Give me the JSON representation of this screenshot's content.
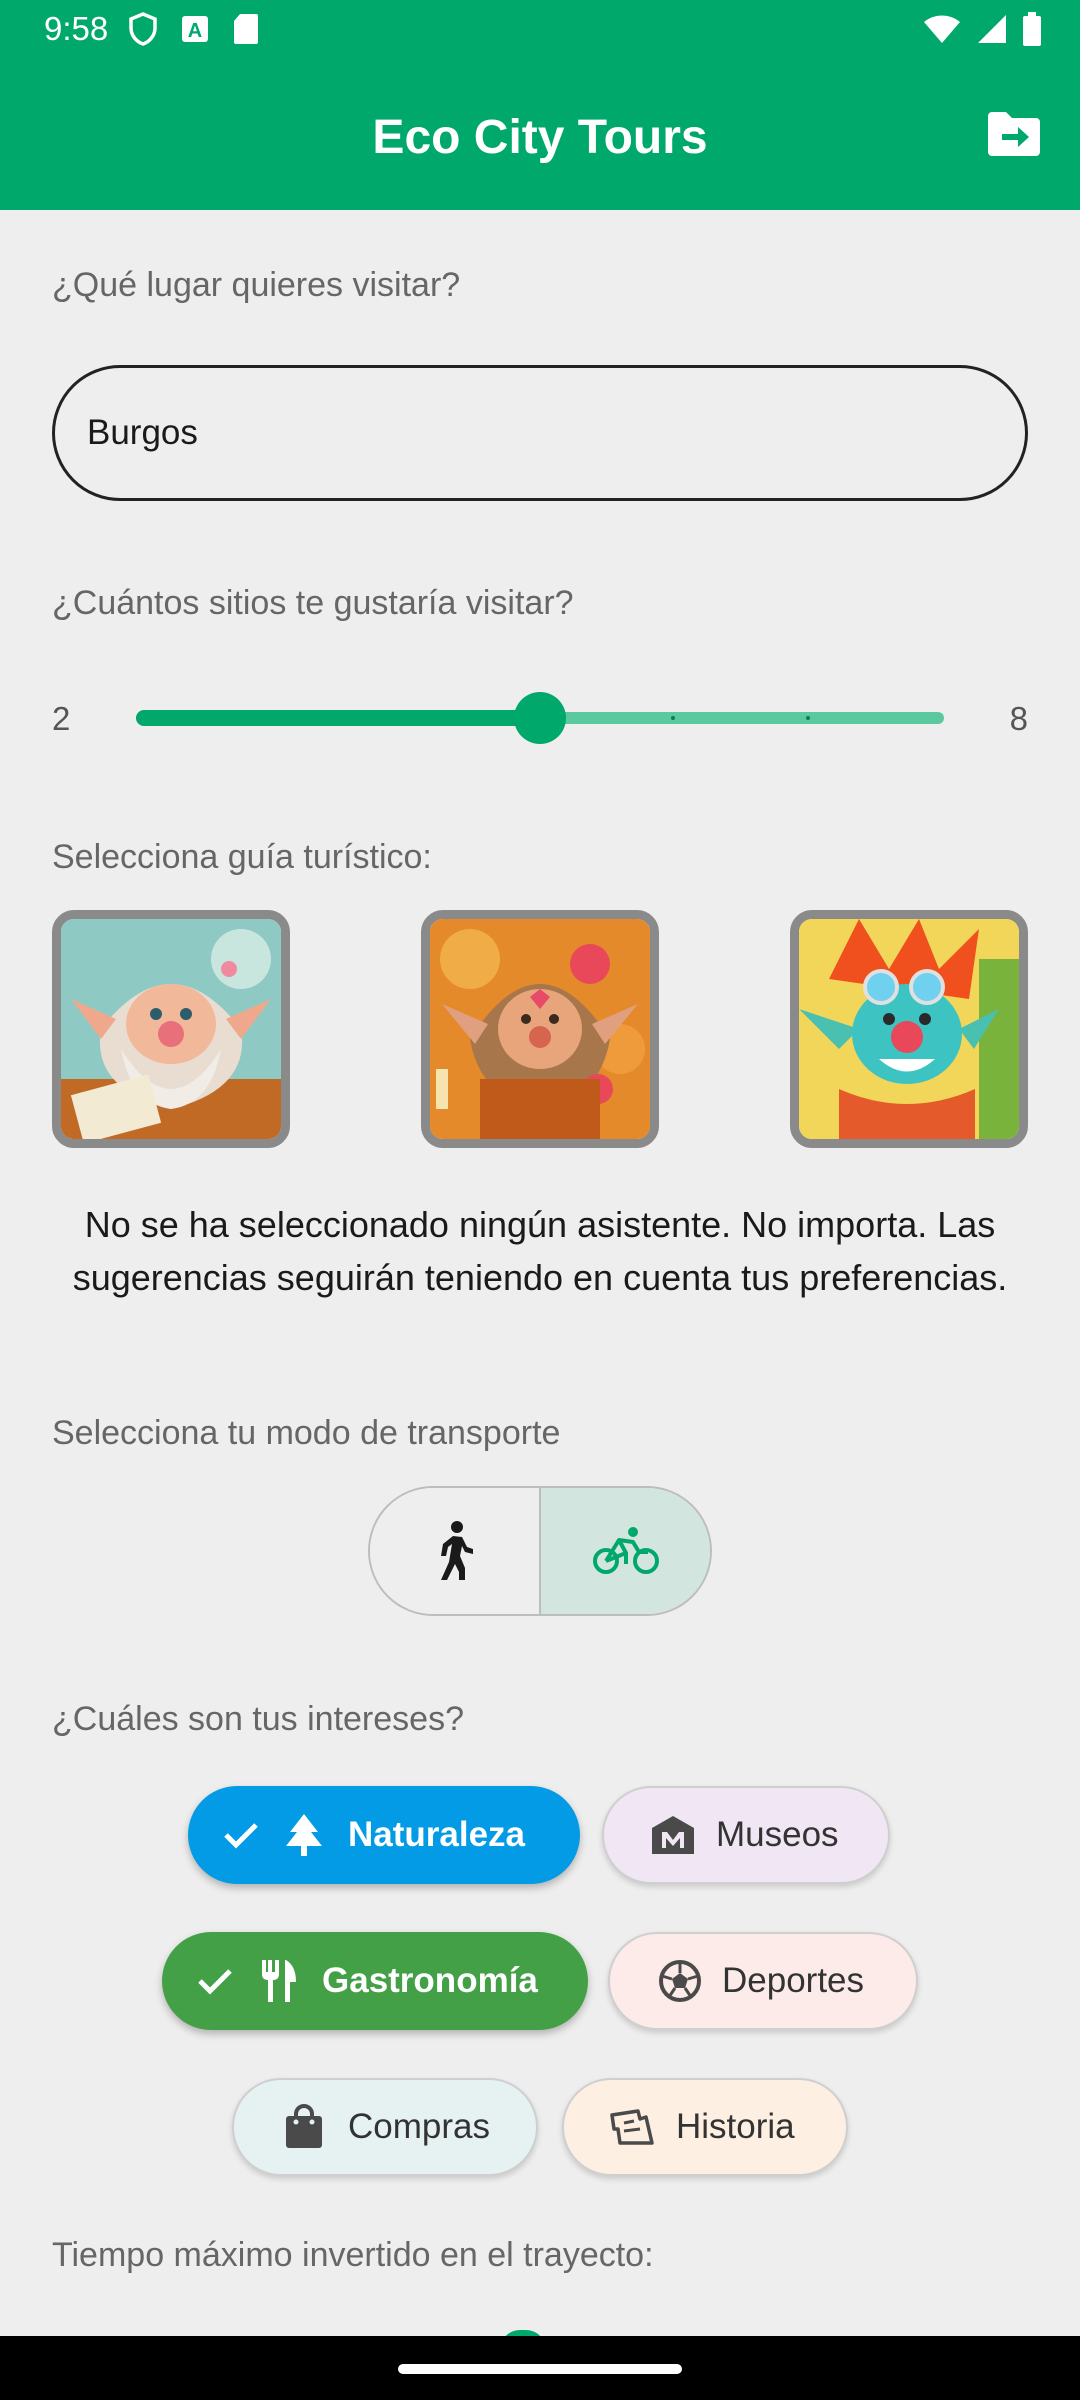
{
  "status": {
    "time": "9:58"
  },
  "appbar": {
    "title": "Eco City Tours"
  },
  "place": {
    "label": "¿Qué lugar quieres visitar?",
    "value": "Burgos"
  },
  "sites": {
    "label": "¿Cuántos sitios te gustaría visitar?",
    "min": "2",
    "max": "8",
    "value": 5
  },
  "guides": {
    "label": "Selecciona guía turístico:",
    "note": "No se ha seleccionado ningún asistente. No importa. Las sugerencias seguirán teniendo en cuenta tus preferencias."
  },
  "transport": {
    "label": "Selecciona tu modo de transporte",
    "options": [
      "walk",
      "bike"
    ],
    "selected": "bike"
  },
  "interests": {
    "label": "¿Cuáles son tus intereses?",
    "items": [
      {
        "label": "Naturaleza",
        "selected": true,
        "color": "#039be5",
        "icon": "tree-icon"
      },
      {
        "label": "Museos",
        "selected": false,
        "color": "#f1e6f3",
        "icon": "museum-icon"
      },
      {
        "label": "Gastronomía",
        "selected": true,
        "color": "#43a047",
        "icon": "restaurant-icon"
      },
      {
        "label": "Deportes",
        "selected": false,
        "color": "#fcebe9",
        "icon": "soccer-ball-icon"
      },
      {
        "label": "Compras",
        "selected": false,
        "color": "#e6f2f2",
        "icon": "shopping-bag-icon"
      },
      {
        "label": "Historia",
        "selected": false,
        "color": "#fdefe2",
        "icon": "history-sign-icon"
      }
    ]
  },
  "time": {
    "label": "Tiempo máximo invertido en el trayecto:"
  },
  "colors": {
    "primary": "#00a86b",
    "background": "#eeeeee"
  }
}
